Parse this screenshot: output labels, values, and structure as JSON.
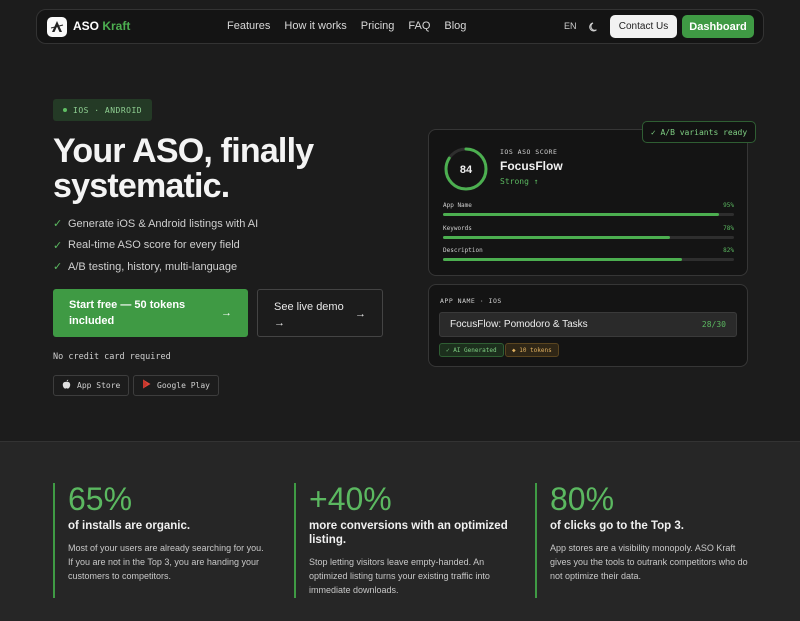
{
  "nav": {
    "logo_prefix": "ASO ",
    "logo_accent": "Kraft",
    "links": [
      "Features",
      "How it works",
      "Pricing",
      "FAQ",
      "Blog"
    ],
    "lang": "EN",
    "contact": "Contact Us",
    "dashboard": "Dashboard"
  },
  "hero": {
    "badge": "IOS · ANDROID",
    "title": "Your ASO, finally systematic.",
    "checks": [
      "Generate iOS & Android listings with AI",
      "Real-time ASO score for every field",
      "A/B testing, history, multi-language"
    ],
    "cta_primary": "Start free — 50 tokens included",
    "cta_secondary": "See live demo →",
    "no_cc": "No credit card required",
    "app_store": "App Store",
    "google_play": "Google Play"
  },
  "score_card": {
    "ab_badge": "✓ A/B variants ready",
    "label": "IOS ASO SCORE",
    "score": "84",
    "score_fraction": 0.84,
    "app_name": "FocusFlow",
    "rating": "Strong ↑",
    "metrics": [
      {
        "name": "App Name",
        "pct": "95%",
        "value": 0.95
      },
      {
        "name": "Keywords",
        "pct": "78%",
        "value": 0.78
      },
      {
        "name": "Description",
        "pct": "82%",
        "value": 0.82
      }
    ]
  },
  "name_card": {
    "label": "APP NAME · IOS",
    "value": "FocusFlow: Pomodoro & Tasks",
    "count": "28/30",
    "tag_ai": "✓ AI Generated",
    "tag_tokens": "◆ 10 tokens"
  },
  "stats": [
    {
      "value": "65%",
      "head": "of installs are organic.",
      "desc": "Most of your users are already searching for you. If you are not in the Top 3, you are handing your customers to competitors."
    },
    {
      "value": "+40%",
      "head": "more conversions with an optimized listing.",
      "desc": "Stop letting visitors leave empty-handed. An optimized listing turns your existing traffic into immediate downloads."
    },
    {
      "value": "80%",
      "head": "of clicks go to the Top 3.",
      "desc": "App stores are a visibility monopoly. ASO Kraft gives you the tools to outrank competitors who do not optimize their data."
    }
  ],
  "colors": {
    "accent": "#3f9a44",
    "background": "#1c1c1c",
    "card": "#141414"
  }
}
